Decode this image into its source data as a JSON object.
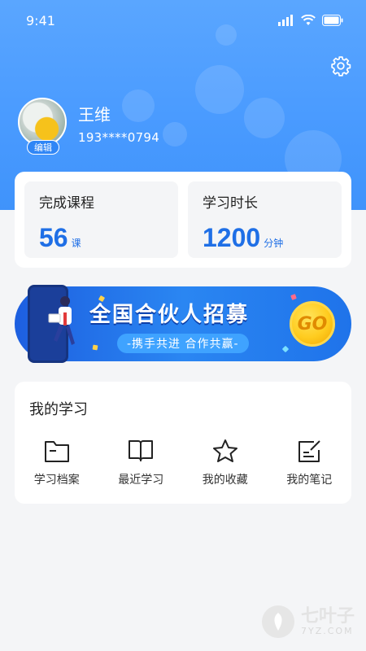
{
  "status_bar": {
    "time": "9:41"
  },
  "profile": {
    "name": "王维",
    "phone": "193****0794",
    "edit_label": "编辑"
  },
  "stats": [
    {
      "title": "完成课程",
      "value": "56",
      "unit": "课"
    },
    {
      "title": "学习时长",
      "value": "1200",
      "unit": "分钟"
    }
  ],
  "banner": {
    "title": "全国合伙人招募",
    "subtitle": "-携手共进 合作共赢-",
    "go_label": "GO"
  },
  "my_study": {
    "title": "我的学习",
    "items": [
      {
        "label": "学习档案",
        "icon": "folder-icon"
      },
      {
        "label": "最近学习",
        "icon": "book-icon"
      },
      {
        "label": "我的收藏",
        "icon": "star-icon"
      },
      {
        "label": "我的笔记",
        "icon": "note-icon"
      }
    ]
  },
  "watermark": {
    "text": "七叶子",
    "sub": "7YZ.COM"
  },
  "colors": {
    "header": "#4a9bff",
    "accent": "#1f6fe6",
    "background": "#f4f5f7"
  }
}
